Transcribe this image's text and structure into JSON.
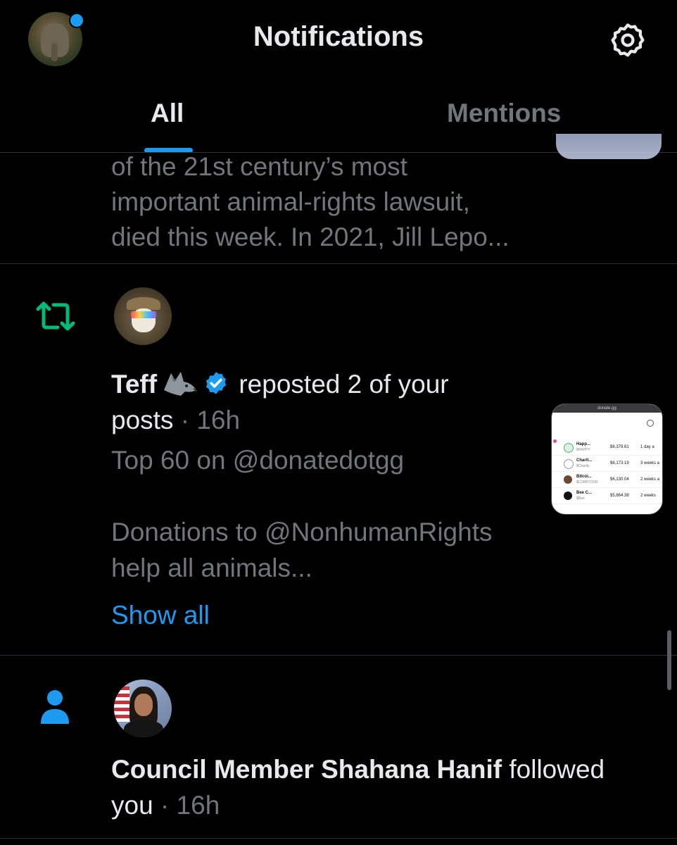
{
  "header": {
    "title": "Notifications",
    "settings_icon": "gear-icon",
    "avatar_icon": "elephant-avatar"
  },
  "tabs": [
    {
      "label": "All",
      "selected": true
    },
    {
      "label": "Mentions",
      "selected": false
    }
  ],
  "notifications": [
    {
      "type": "partial-post",
      "text_lines": [
        "of the 21st century’s most",
        "important animal-rights lawsuit,",
        "died this week. In 2021, Jill Lepo..."
      ]
    },
    {
      "type": "repost",
      "icon": "repost-icon",
      "user_name": "Teff",
      "user_emoji": "🐺",
      "verified": true,
      "action": " reposted 2 of your",
      "action_line2": "posts",
      "separator": " · ",
      "time": "16h",
      "preview_line1": "Top 60 on @donatedotgg",
      "preview_line2": "Donations to @NonhumanRights",
      "preview_line3": "help all animals...",
      "show_all_label": "Show all",
      "thumbnail": {
        "url_bar": "donate.gg",
        "rows": [
          {
            "name": "Happ...",
            "ticker": "$HAPPY",
            "amount": "$6,379.61",
            "time": "1 day a"
          },
          {
            "name": "Charit...",
            "ticker": "$Charity",
            "amount": "$6,173.19",
            "time": "3 weeks a"
          },
          {
            "name": "Bitcoi...",
            "ticker": "$LOBBYODR",
            "amount": "$6,130.04",
            "time": "2 weeks a"
          },
          {
            "name": "Bee C...",
            "ticker": "$Bee",
            "amount": "$5,864.38",
            "time": "2 weeks"
          }
        ]
      }
    },
    {
      "type": "follow",
      "icon": "person-icon",
      "user_name": "Council Member Shahana Hanif",
      "action": " followed",
      "action_line2": "you",
      "separator": " · ",
      "time": "16h"
    }
  ],
  "colors": {
    "background": "#000000",
    "accent": "#1d9bf0",
    "repost_green": "#00ba7c",
    "muted_text": "#71767b",
    "divider": "#2f3336"
  }
}
